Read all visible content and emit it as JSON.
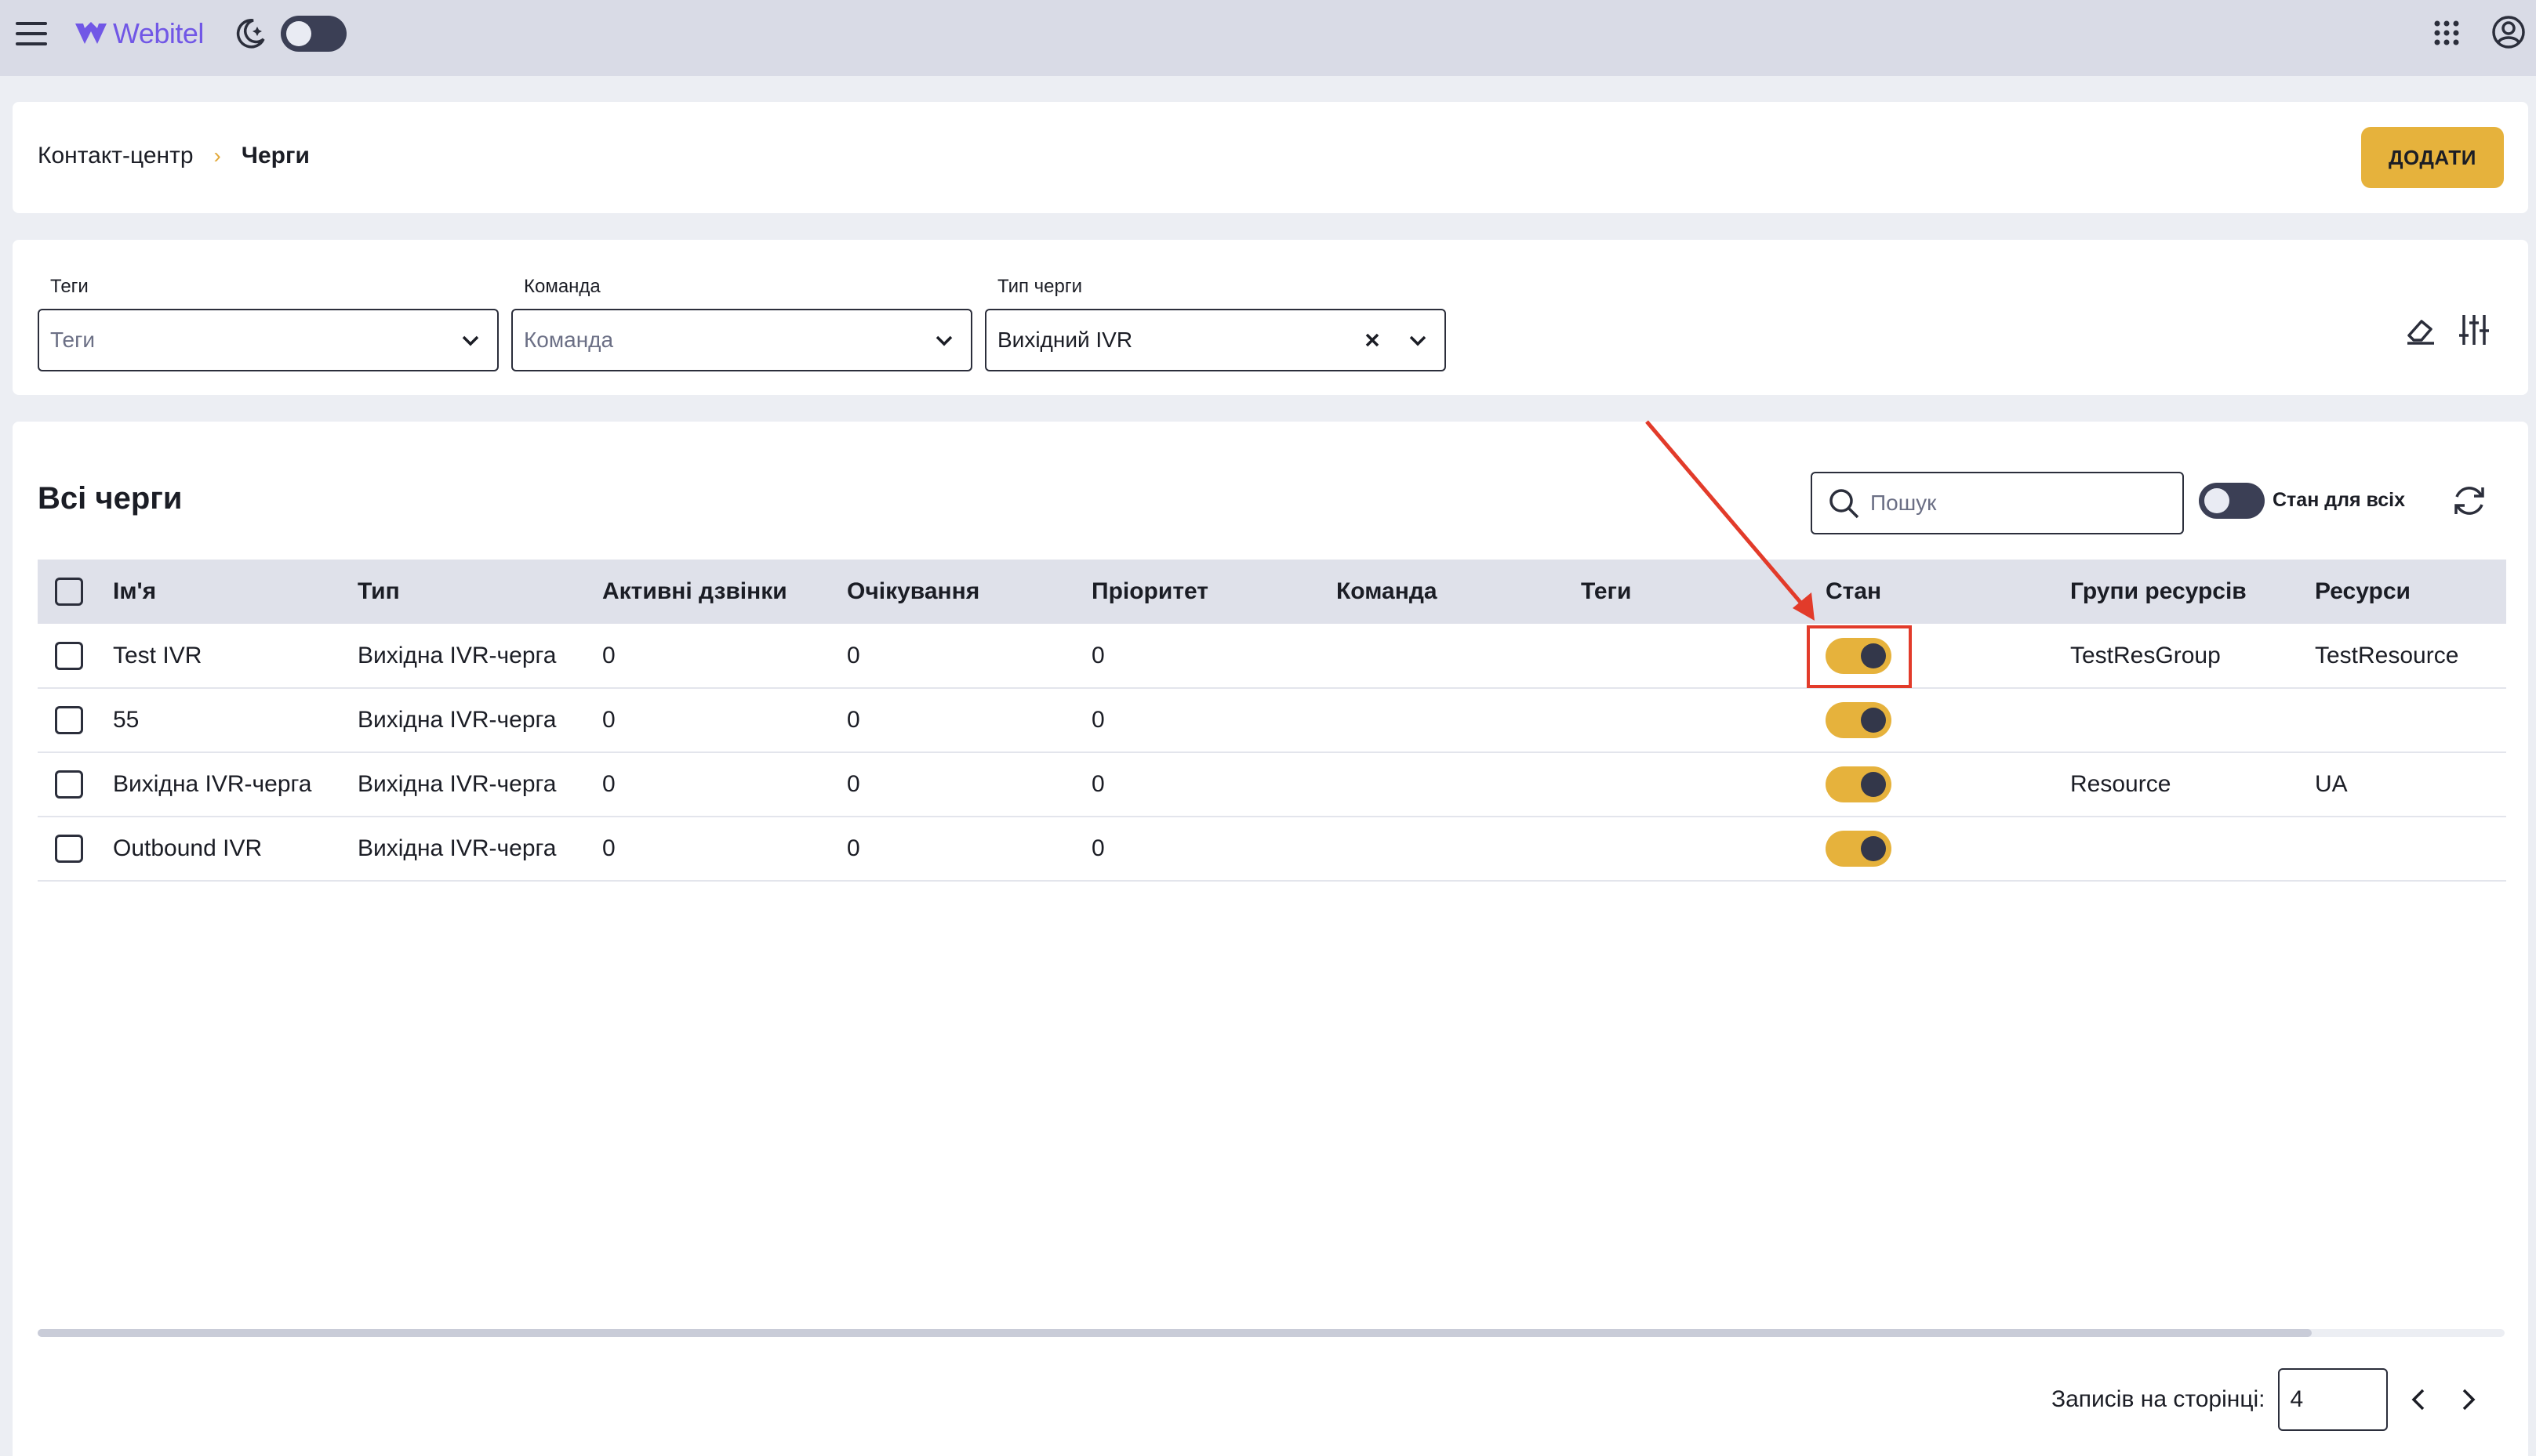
{
  "topbar": {
    "logo_text": "Webitel",
    "icons": [
      "hamburger-menu-icon",
      "moon-icon",
      "apps-grid-icon",
      "account-icon"
    ]
  },
  "breadcrumb": {
    "items": [
      "Контакт-центр",
      "Черги"
    ],
    "separator": "›"
  },
  "header": {
    "add_label": "ДОДАТИ"
  },
  "filters": [
    {
      "label": "Теги",
      "value": "",
      "placeholder": "Теги"
    },
    {
      "label": "Команда",
      "value": "",
      "placeholder": "Команда"
    },
    {
      "label": "Тип черги",
      "value": "Вихідний IVR",
      "placeholder": ""
    }
  ],
  "table": {
    "title": "Всі черги",
    "search_placeholder": "Пошук",
    "state_all_label": "Стан для всіх",
    "columns": [
      "Ім'я",
      "Тип",
      "Активні дзвінки",
      "Очікування",
      "Пріоритет",
      "Команда",
      "Теги",
      "Стан",
      "Групи ресурсів",
      "Ресурси"
    ],
    "rows": [
      {
        "name": "Test IVR",
        "type": "Вихідна IVR-черга",
        "active": "0",
        "waiting": "0",
        "priority": "0",
        "team": "",
        "tags": "",
        "state": true,
        "res_groups": "TestResGroup",
        "resources": "TestResource"
      },
      {
        "name": "55",
        "type": "Вихідна IVR-черга",
        "active": "0",
        "waiting": "0",
        "priority": "0",
        "team": "",
        "tags": "",
        "state": true,
        "res_groups": "",
        "resources": ""
      },
      {
        "name": "Вихідна IVR-черга",
        "type": "Вихідна IVR-черга",
        "active": "0",
        "waiting": "0",
        "priority": "0",
        "team": "",
        "tags": "",
        "state": true,
        "res_groups": "Resource",
        "resources": "UA"
      },
      {
        "name": "Outbound IVR",
        "type": "Вихідна IVR-черга",
        "active": "0",
        "waiting": "0",
        "priority": "0",
        "team": "",
        "tags": "",
        "state": true,
        "res_groups": "",
        "resources": ""
      }
    ]
  },
  "pagination": {
    "label": "Записів на сторінці:",
    "size": "4"
  },
  "colors": {
    "accent": "#e6b23c",
    "brand": "#7157e6",
    "annotation": "#e23b2a",
    "toggle_off": "#3b3f55"
  }
}
